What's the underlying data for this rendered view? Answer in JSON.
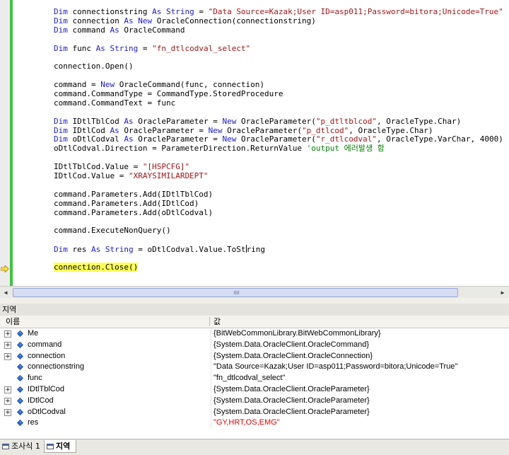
{
  "editor": {
    "lines": [
      {
        "parts": [
          {
            "t": "Dim ",
            "c": "kw"
          },
          {
            "t": "connectionstring "
          },
          {
            "t": "As String",
            "c": "kw"
          },
          {
            "t": " = "
          },
          {
            "t": "\"Data Source=Kazak;User ID=asp011;Password=bitora;Unicode=True\"",
            "c": "str"
          }
        ]
      },
      {
        "parts": [
          {
            "t": "Dim ",
            "c": "kw"
          },
          {
            "t": "connection "
          },
          {
            "t": "As New ",
            "c": "kw"
          },
          {
            "t": "OracleConnection(connectionstring)"
          }
        ]
      },
      {
        "parts": [
          {
            "t": "Dim ",
            "c": "kw"
          },
          {
            "t": "command "
          },
          {
            "t": "As ",
            "c": "kw"
          },
          {
            "t": "OracleCommand"
          }
        ]
      },
      {
        "parts": []
      },
      {
        "parts": [
          {
            "t": "Dim ",
            "c": "kw"
          },
          {
            "t": "func "
          },
          {
            "t": "As String",
            "c": "kw"
          },
          {
            "t": " = "
          },
          {
            "t": "\"fn_dtlcodval_select\"",
            "c": "str"
          }
        ]
      },
      {
        "parts": []
      },
      {
        "parts": [
          {
            "t": "connection.Open()"
          }
        ]
      },
      {
        "parts": []
      },
      {
        "parts": [
          {
            "t": "command = "
          },
          {
            "t": "New ",
            "c": "kw"
          },
          {
            "t": "OracleCommand(func, connection)"
          }
        ]
      },
      {
        "parts": [
          {
            "t": "command.CommandType = CommandType.StoredProcedure"
          }
        ]
      },
      {
        "parts": [
          {
            "t": "command.CommandText = func"
          }
        ]
      },
      {
        "parts": []
      },
      {
        "parts": [
          {
            "t": "Dim ",
            "c": "kw"
          },
          {
            "t": "IDtlTblCod "
          },
          {
            "t": "As ",
            "c": "kw"
          },
          {
            "t": "OracleParameter = "
          },
          {
            "t": "New ",
            "c": "kw"
          },
          {
            "t": "OracleParameter("
          },
          {
            "t": "\"p_dtltblcod\"",
            "c": "str"
          },
          {
            "t": ", OracleType.Char)"
          }
        ]
      },
      {
        "parts": [
          {
            "t": "Dim ",
            "c": "kw"
          },
          {
            "t": "IDtlCod "
          },
          {
            "t": "As ",
            "c": "kw"
          },
          {
            "t": "OracleParameter = "
          },
          {
            "t": "New ",
            "c": "kw"
          },
          {
            "t": "OracleParameter("
          },
          {
            "t": "\"p_dtlcod\"",
            "c": "str"
          },
          {
            "t": ", OracleType.Char)"
          }
        ]
      },
      {
        "parts": [
          {
            "t": "Dim ",
            "c": "kw"
          },
          {
            "t": "oDtlCodval "
          },
          {
            "t": "As ",
            "c": "kw"
          },
          {
            "t": "OracleParameter = "
          },
          {
            "t": "New ",
            "c": "kw"
          },
          {
            "t": "OracleParameter("
          },
          {
            "t": "\"r_dtlcodval\"",
            "c": "str"
          },
          {
            "t": ", OracleType.VarChar, 4000)"
          }
        ]
      },
      {
        "parts": [
          {
            "t": "oDtlCodval.Direction = ParameterDirection.ReturnValue "
          },
          {
            "t": "'output 에러발생 함",
            "c": "cmt"
          }
        ]
      },
      {
        "parts": []
      },
      {
        "parts": [
          {
            "t": "IDtlTblCod.Value = "
          },
          {
            "t": "\"[HSPCFG]\"",
            "c": "str"
          }
        ]
      },
      {
        "parts": [
          {
            "t": "IDtlCod.Value = "
          },
          {
            "t": "\"XRAYSIMILARDEPT\"",
            "c": "str"
          }
        ]
      },
      {
        "parts": []
      },
      {
        "parts": [
          {
            "t": "command.Parameters.Add(IDtlTblCod)"
          }
        ]
      },
      {
        "parts": [
          {
            "t": "command.Parameters.Add(IDtlCod)"
          }
        ]
      },
      {
        "parts": [
          {
            "t": "command.Parameters.Add(oDtlCodval)"
          }
        ]
      },
      {
        "parts": []
      },
      {
        "parts": [
          {
            "t": "command.ExecuteNonQuery()"
          }
        ]
      },
      {
        "parts": []
      },
      {
        "parts": [
          {
            "t": "Dim ",
            "c": "kw"
          },
          {
            "t": "res "
          },
          {
            "t": "As String",
            "c": "kw"
          },
          {
            "t": " = oDtlCodval.Value.ToSt"
          },
          {
            "t": "",
            "c": "caret"
          },
          {
            "t": "ring"
          }
        ]
      },
      {
        "parts": []
      },
      {
        "parts": [
          {
            "t": "connection.Close()",
            "c": "hl"
          }
        ]
      }
    ]
  },
  "locals": {
    "title": "지역",
    "col_name": "이름",
    "col_value": "값",
    "rows": [
      {
        "name": "Me",
        "value": "{BitWebCommonLibrary.BitWebCommonLibrary}",
        "expandable": true,
        "red": false
      },
      {
        "name": "command",
        "value": "{System.Data.OracleClient.OracleCommand}",
        "expandable": true,
        "red": false
      },
      {
        "name": "connection",
        "value": "{System.Data.OracleClient.OracleConnection}",
        "expandable": true,
        "red": false
      },
      {
        "name": "connectionstring",
        "value": "\"Data Source=Kazak;User ID=asp011;Password=bitora;Unicode=True\"",
        "expandable": false,
        "red": false
      },
      {
        "name": "func",
        "value": "\"fn_dtlcodval_select\"",
        "expandable": false,
        "red": false
      },
      {
        "name": "IDtlTblCod",
        "value": "{System.Data.OracleClient.OracleParameter}",
        "expandable": true,
        "red": false
      },
      {
        "name": "IDtlCod",
        "value": "{System.Data.OracleClient.OracleParameter}",
        "expandable": true,
        "red": false
      },
      {
        "name": "oDtlCodval",
        "value": "{System.Data.OracleClient.OracleParameter}",
        "expandable": true,
        "red": false
      },
      {
        "name": "res",
        "value": "\"GY,HRT,OS,EMG\"",
        "expandable": false,
        "red": true
      }
    ]
  },
  "tabs": [
    {
      "label": "조사식 1",
      "active": false
    },
    {
      "label": "지역",
      "active": true
    }
  ],
  "colors": {
    "keyword": "#1a1acc",
    "string": "#a31515",
    "comment": "#008000",
    "current_line": "#ffff5c",
    "changed_value": "#e00000"
  },
  "icons": {
    "execution_pointer": "yellow-arrow-icon",
    "variable": "blue-diamond-icon",
    "expand": "plus-box-icon"
  }
}
